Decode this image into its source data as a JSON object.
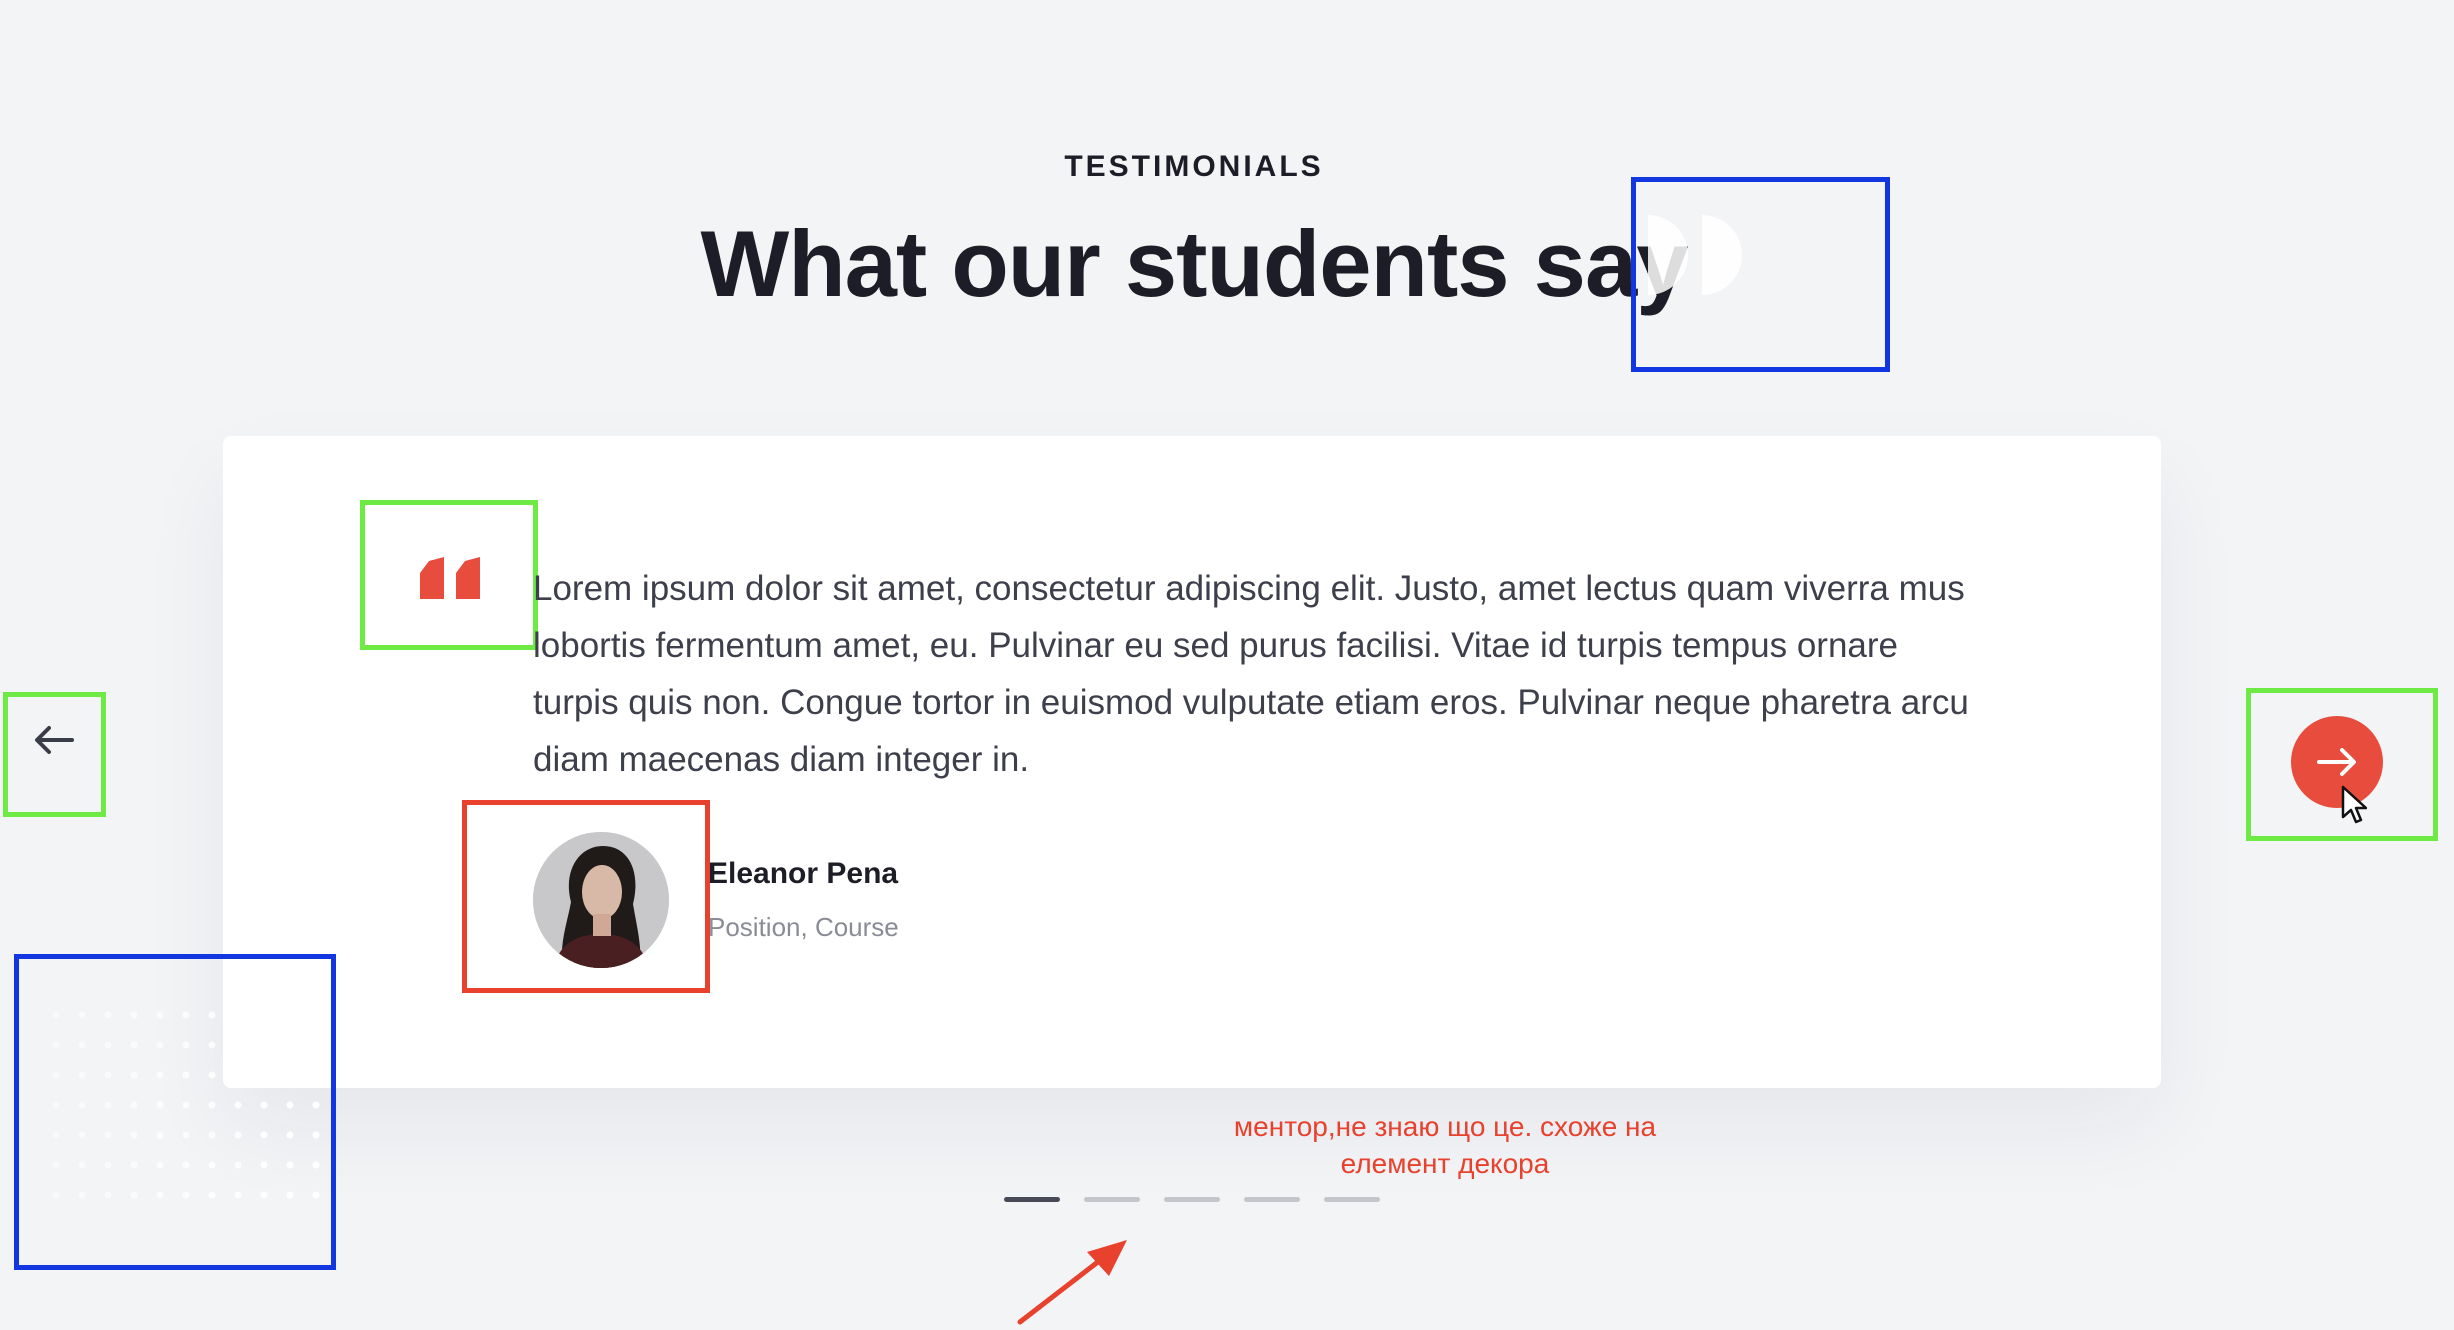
{
  "section": {
    "eyebrow": "TESTIMONIALS",
    "title": "What our students say"
  },
  "testimonial": {
    "text": "Lorem ipsum dolor sit amet, consectetur adipiscing elit. Justo, amet lectus quam viverra mus lobortis fermentum amet, eu. Pulvinar eu sed purus facilisi. Vitae id turpis tempus ornare turpis quis non. Congue tortor in euismod vulputate etiam eros. Pulvinar neque pharetra arcu diam maecenas diam integer in.",
    "author_name": "Eleanor Pena",
    "author_role": "Position, Course"
  },
  "pagination": {
    "total": 5,
    "active_index": 0
  },
  "annotation": {
    "note": "ментор,не знаю що це. схоже на елемент декора"
  },
  "icons": {
    "prev": "arrow-left-icon",
    "next": "arrow-right-icon",
    "quote": "quote-icon",
    "cursor": "mouse-cursor-icon"
  },
  "colors": {
    "background": "#f3f4f6",
    "card": "#ffffff",
    "accent": "#e84c3d",
    "heading": "#1c1d26",
    "body_text": "#3d3f4b",
    "muted": "#8a8c95",
    "annotation_blue": "#1236e0",
    "annotation_green": "#6dea43",
    "annotation_red": "#e8412e"
  }
}
